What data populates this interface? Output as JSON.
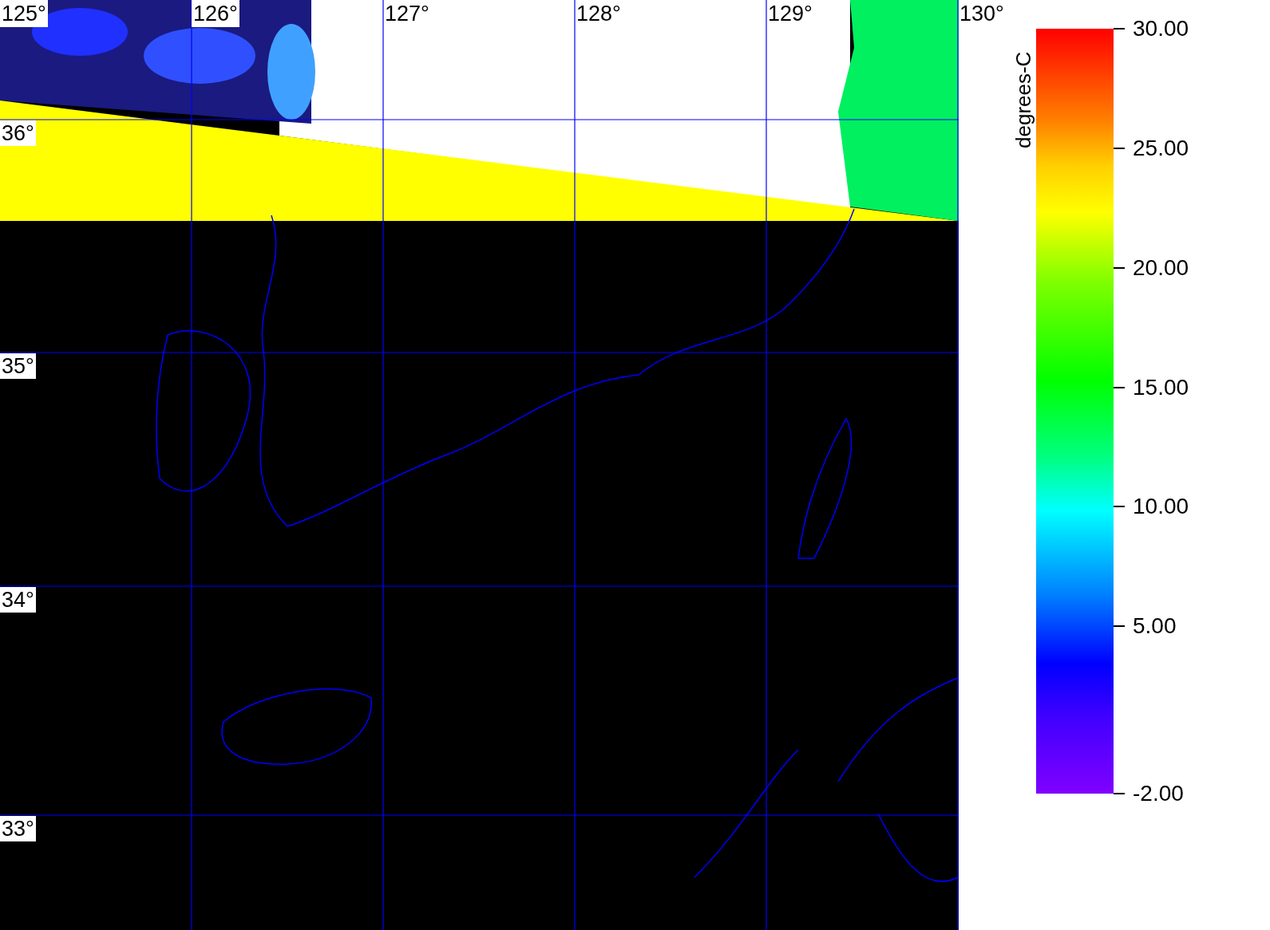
{
  "map": {
    "longitude_labels": [
      {
        "text": "125°",
        "boxed": true
      },
      {
        "text": "126°",
        "boxed": true
      },
      {
        "text": "127°",
        "boxed": false
      },
      {
        "text": "128°",
        "boxed": false
      },
      {
        "text": "129°",
        "boxed": false
      },
      {
        "text": "130°",
        "boxed": false
      }
    ],
    "latitude_labels": [
      "36°",
      "35°",
      "34°",
      "33°"
    ]
  },
  "colorbar": {
    "title": "degrees-C",
    "ticks": [
      {
        "label": "30.00",
        "level": 1
      },
      {
        "label": "25.00",
        "level": 0.8437
      },
      {
        "label": "20.00",
        "level": 0.6875
      },
      {
        "label": "15.00",
        "level": 0.5312
      },
      {
        "label": "10.00",
        "level": 0.375
      },
      {
        "label": "5.00",
        "level": 0.2187
      },
      {
        "label": "-2.00",
        "level": 0
      }
    ]
  }
}
